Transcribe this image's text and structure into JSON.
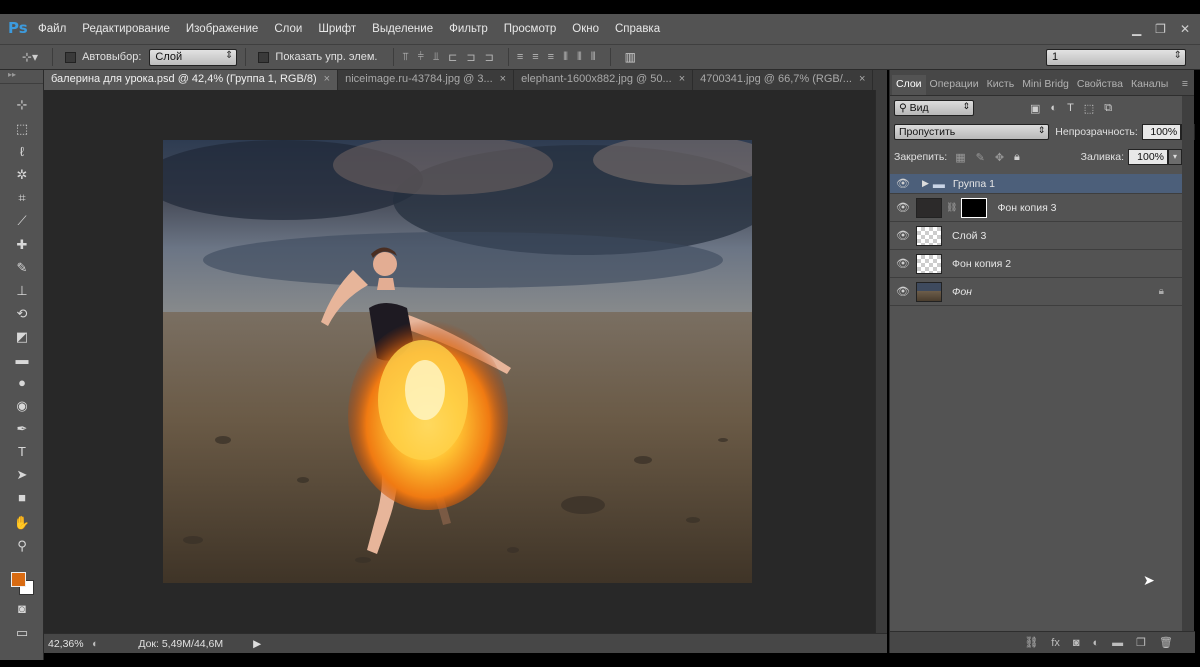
{
  "app": {
    "logo": "Ps"
  },
  "menu": [
    "Файл",
    "Редактирование",
    "Изображение",
    "Слои",
    "Шрифт",
    "Выделение",
    "Фильтр",
    "Просмотр",
    "Окно",
    "Справка"
  ],
  "window_controls": {
    "minimize": "▁",
    "restore": "❐",
    "close": "✕"
  },
  "options": {
    "autoselect_label": "Автовыбор:",
    "autoselect_value": "Слой",
    "show_controls_label": "Показать упр. элем.",
    "workspace_value": "1"
  },
  "tabs": [
    {
      "label": "балерина для урока.psd @ 42,4% (Группа 1, RGB/8)",
      "active": true
    },
    {
      "label": "niceimage.ru-43784.jpg @ 3...",
      "active": false
    },
    {
      "label": "elephant-1600x882.jpg @ 50...",
      "active": false
    },
    {
      "label": "4700341.jpg @ 66,7% (RGB/...",
      "active": false
    }
  ],
  "tab_close": "×",
  "status": {
    "zoom": "42,36%",
    "doc_info": "Док: 5,49M/44,6M"
  },
  "panel_tabs": [
    "Слои",
    "Операции",
    "Кисть",
    "Mini Bridg",
    "Свойства",
    "Каналы"
  ],
  "layers_panel": {
    "filter_label": "Вид",
    "blend_mode": "Пропустить",
    "opacity_label": "Непрозрачность:",
    "opacity_value": "100%",
    "lock_label": "Закрепить:",
    "fill_label": "Заливка:",
    "fill_value": "100%",
    "layers": [
      {
        "name": "Группа 1",
        "type": "group",
        "selected": true
      },
      {
        "name": "Фон копия 3",
        "type": "masked",
        "selected": false
      },
      {
        "name": "Слой 3",
        "type": "transparent",
        "selected": false
      },
      {
        "name": "Фон копия 2",
        "type": "transparent",
        "selected": false
      },
      {
        "name": "Фон",
        "type": "background",
        "selected": false,
        "locked": true
      }
    ]
  },
  "colors": {
    "foreground": "#d96b12",
    "background": "#ffffff",
    "ui_gray": "#535353",
    "selection": "#4c5f7a"
  }
}
